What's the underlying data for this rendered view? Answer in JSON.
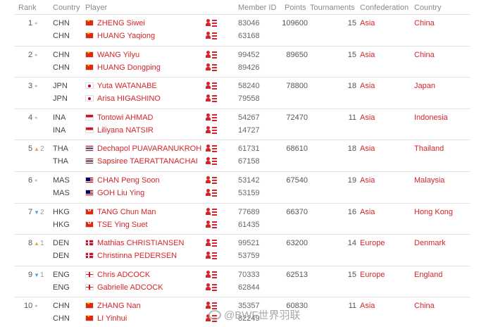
{
  "header": {
    "rank": "Rank",
    "country": "Country",
    "player": "Player",
    "member_id": "Member ID",
    "points": "Points",
    "tournaments": "Tournaments",
    "confederation": "Confederation",
    "country2": "Country"
  },
  "rows": [
    {
      "rank": "1",
      "change_dir": "none",
      "change": "",
      "countries": [
        "CHN",
        "CHN"
      ],
      "flag": "chn",
      "players": [
        "ZHENG Siwei",
        "HUANG Yaqiong"
      ],
      "ids": [
        "83046",
        "63168"
      ],
      "points": "109600",
      "tournaments": "15",
      "confederation": "Asia",
      "country": "China"
    },
    {
      "rank": "2",
      "change_dir": "none",
      "change": "",
      "countries": [
        "CHN",
        "CHN"
      ],
      "flag": "chn",
      "players": [
        "WANG Yilyu",
        "HUANG Dongping"
      ],
      "ids": [
        "99452",
        "89426"
      ],
      "points": "89650",
      "tournaments": "15",
      "confederation": "Asia",
      "country": "China"
    },
    {
      "rank": "3",
      "change_dir": "none",
      "change": "",
      "countries": [
        "JPN",
        "JPN"
      ],
      "flag": "jpn",
      "players": [
        "Yuta WATANABE",
        "Arisa HIGASHINO"
      ],
      "ids": [
        "58240",
        "79558"
      ],
      "points": "78800",
      "tournaments": "18",
      "confederation": "Asia",
      "country": "Japan"
    },
    {
      "rank": "4",
      "change_dir": "none",
      "change": "",
      "countries": [
        "INA",
        "INA"
      ],
      "flag": "ina",
      "players": [
        "Tontowi AHMAD",
        "Liliyana NATSIR"
      ],
      "ids": [
        "54267",
        "14727"
      ],
      "points": "72470",
      "tournaments": "11",
      "confederation": "Asia",
      "country": "Indonesia"
    },
    {
      "rank": "5",
      "change_dir": "up",
      "change": "2",
      "countries": [
        "THA",
        "THA"
      ],
      "flag": "tha",
      "players": [
        "Dechapol PUAVARANUKROH",
        "Sapsiree TAERATTANACHAI"
      ],
      "ids": [
        "61731",
        "67158"
      ],
      "points": "68610",
      "tournaments": "18",
      "confederation": "Asia",
      "country": "Thailand"
    },
    {
      "rank": "6",
      "change_dir": "none",
      "change": "",
      "countries": [
        "MAS",
        "MAS"
      ],
      "flag": "mas",
      "players": [
        "CHAN Peng Soon",
        "GOH Liu Ying"
      ],
      "ids": [
        "53142",
        "53159"
      ],
      "points": "67540",
      "tournaments": "19",
      "confederation": "Asia",
      "country": "Malaysia"
    },
    {
      "rank": "7",
      "change_dir": "down",
      "change": "2",
      "countries": [
        "HKG",
        "HKG"
      ],
      "flag": "hkg",
      "players": [
        "TANG Chun Man",
        "TSE Ying Suet"
      ],
      "ids": [
        "77689",
        "61435"
      ],
      "points": "66370",
      "tournaments": "16",
      "confederation": "Asia",
      "country": "Hong Kong"
    },
    {
      "rank": "8",
      "change_dir": "up",
      "change": "1",
      "countries": [
        "DEN",
        "DEN"
      ],
      "flag": "den",
      "players": [
        "Mathias CHRISTIANSEN",
        "Christinna PEDERSEN"
      ],
      "ids": [
        "99521",
        "53759"
      ],
      "points": "63200",
      "tournaments": "14",
      "confederation": "Europe",
      "country": "Denmark"
    },
    {
      "rank": "9",
      "change_dir": "down",
      "change": "1",
      "countries": [
        "ENG",
        "ENG"
      ],
      "flag": "eng",
      "players": [
        "Chris ADCOCK",
        "Gabrielle ADCOCK"
      ],
      "ids": [
        "70333",
        "62844"
      ],
      "points": "62513",
      "tournaments": "15",
      "confederation": "Europe",
      "country": "England"
    },
    {
      "rank": "10",
      "change_dir": "none",
      "change": "",
      "countries": [
        "CHN",
        "CHN"
      ],
      "flag": "chn",
      "players": [
        "ZHANG Nan",
        "LI Yinhui"
      ],
      "ids": [
        "35357",
        "82249"
      ],
      "points": "60830",
      "tournaments": "11",
      "confederation": "Asia",
      "country": "China"
    }
  ],
  "icons": {
    "player_profile": "player-profile-icon",
    "rank_same": "rank-unchanged-dot",
    "rank_up": "arrow-up-icon",
    "rank_down": "arrow-down-icon"
  },
  "colors": {
    "link": "#d4252a",
    "up": "#e8a33d",
    "down": "#4aa3df"
  },
  "watermark": "@BWF世界羽联"
}
